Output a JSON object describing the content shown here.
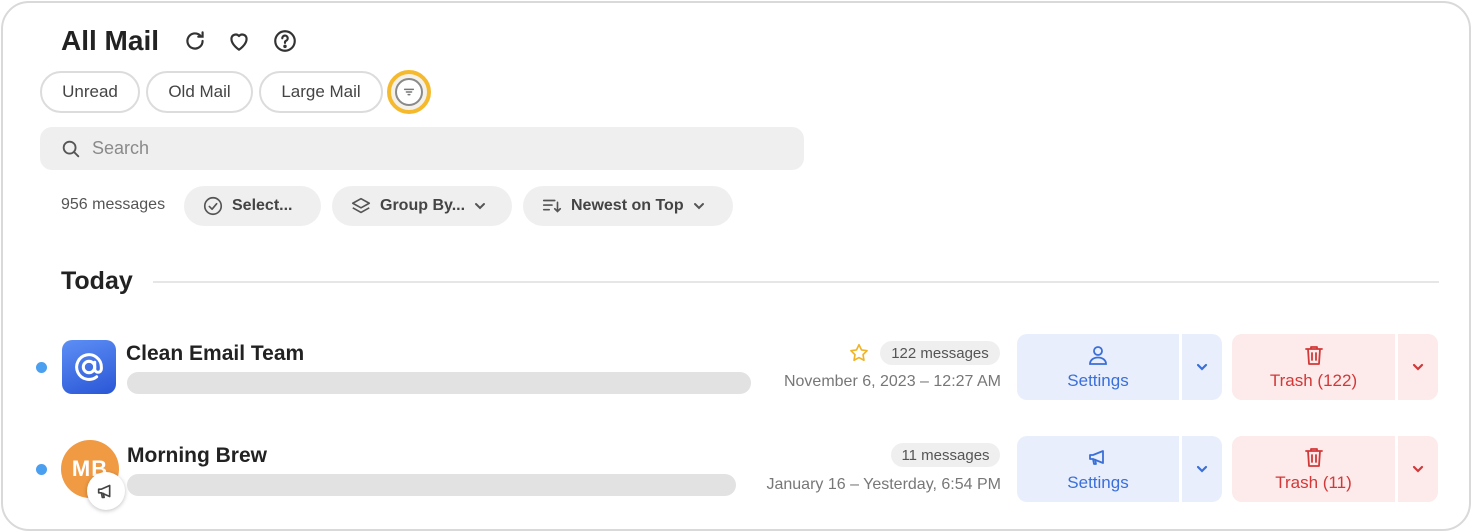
{
  "header": {
    "title": "All Mail",
    "icons": [
      "refresh-icon",
      "heart-icon",
      "help-icon"
    ]
  },
  "chips": [
    {
      "label": "Unread"
    },
    {
      "label": "Old Mail"
    },
    {
      "label": "Large Mail"
    }
  ],
  "filter": {
    "icon": "filter-icon",
    "accent": "#f5b92d"
  },
  "search": {
    "placeholder": "Search"
  },
  "toolbar": {
    "count": "956 messages",
    "select_label": "Select...",
    "group_label": "Group By...",
    "sort_label": "Newest on Top"
  },
  "section": {
    "title": "Today"
  },
  "rows": [
    {
      "sender": "Clean Email Team",
      "count": "122 messages",
      "date": "November 6, 2023 – 12:27 AM",
      "starred": true,
      "settings_label": "Settings",
      "trash_label": "Trash (122)",
      "avatar_icon": "at-sign-icon"
    },
    {
      "sender": "Morning Brew",
      "initials": "MB",
      "count": "11 messages",
      "date": "January 16 – Yesterday, 6:54 PM",
      "starred": false,
      "settings_label": "Settings",
      "trash_label": "Trash (11)",
      "avatar_icon": "megaphone-icon"
    }
  ],
  "colors": {
    "unread": "#4a9ff0",
    "settings_bg": "#e8eefc",
    "settings_text": "#3a6fd8",
    "trash_bg": "#fdeaea",
    "trash_text": "#d23838",
    "star": "#f0b429"
  }
}
